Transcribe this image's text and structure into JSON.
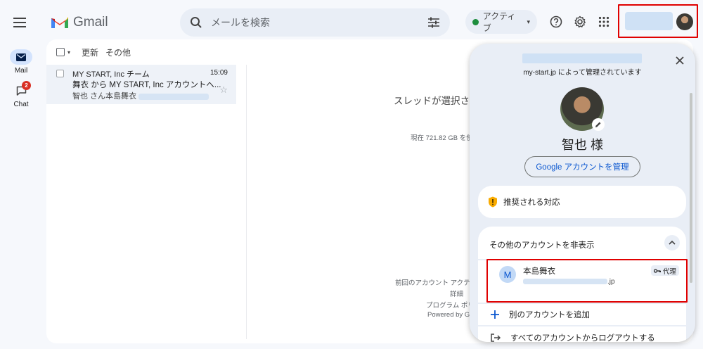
{
  "app": {
    "name": "Gmail"
  },
  "search": {
    "placeholder": "メールを検索"
  },
  "status": {
    "label": "アクティブ",
    "color": "#1e8e3e"
  },
  "rail": {
    "mail_label": "Mail",
    "chat_label": "Chat",
    "chat_badge": "2"
  },
  "toolbar": {
    "refresh": "更新",
    "more": "その他"
  },
  "email": {
    "sender": "MY START, Inc チーム",
    "time": "15:09",
    "subject": "舞衣 から MY START, Inc アカウントへ...",
    "snippet": "智也 さん本島舞衣"
  },
  "main": {
    "no_thread": "スレッドが選択され",
    "storage": "現在 721.82 GB を使",
    "last_activity": "前回のアカウント アクテ",
    "details": "詳細",
    "program": "プログラム ポリ",
    "powered": "Powered by G"
  },
  "popover": {
    "managed_by": "my-start.jp によって管理されています",
    "greeting": "智也 様",
    "manage_button": "Google アカウントを管理",
    "recommended": "推奨される対応",
    "hide_others": "その他のアカウントを非表示",
    "other_account": {
      "initial": "M",
      "name": "本島舞衣",
      "email_suffix": ".jp",
      "badge": "代理"
    },
    "add_account": "別のアカウントを追加",
    "logout_all": "すべてのアカウントからログアウトする"
  },
  "colors": {
    "accent": "#0b57d0",
    "highlight": "#e00000",
    "warning": "#f9ab00"
  }
}
